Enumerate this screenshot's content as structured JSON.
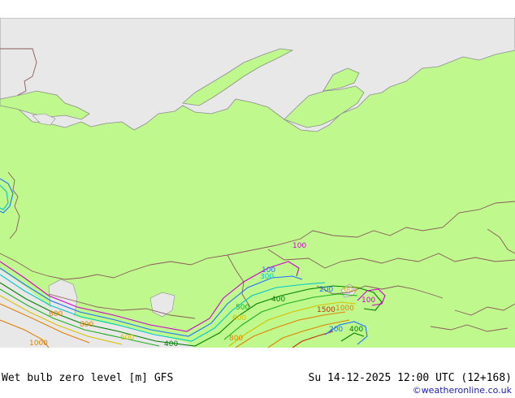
{
  "footer": {
    "title": "Wet bulb zero level [m] GFS",
    "valid_time": "Su 14-12-2025 12:00 UTC (12+168)",
    "credit": "©weatheronline.co.uk"
  },
  "colors": {
    "land": "#bff98e",
    "sea": "#e8e8e8",
    "border": "#8a5a5a",
    "coast": "#8c8c8c"
  },
  "contour_labels": [
    {
      "text": "100",
      "color": "#d000d0"
    },
    {
      "text": "100",
      "color": "#2070ff"
    },
    {
      "text": "300",
      "color": "#00c8c8"
    },
    {
      "text": "200",
      "color": "#2070ff"
    },
    {
      "text": "600",
      "color": "#d8c000"
    },
    {
      "text": "100",
      "color": "#d000d0"
    },
    {
      "text": "400",
      "color": "#008000"
    },
    {
      "text": "500",
      "color": "#20b020"
    },
    {
      "text": "1500",
      "color": "#c03000"
    },
    {
      "text": "1000",
      "color": "#e08000"
    },
    {
      "text": "800",
      "color": "#e08000"
    },
    {
      "text": "800",
      "color": "#e08000"
    },
    {
      "text": "600",
      "color": "#d8c000"
    },
    {
      "text": "200",
      "color": "#2070ff"
    },
    {
      "text": "400",
      "color": "#008000"
    },
    {
      "text": "800",
      "color": "#e08000"
    },
    {
      "text": "600",
      "color": "#d8c000"
    },
    {
      "text": "1000",
      "color": "#e08000"
    },
    {
      "text": "400",
      "color": "#008000"
    }
  ]
}
